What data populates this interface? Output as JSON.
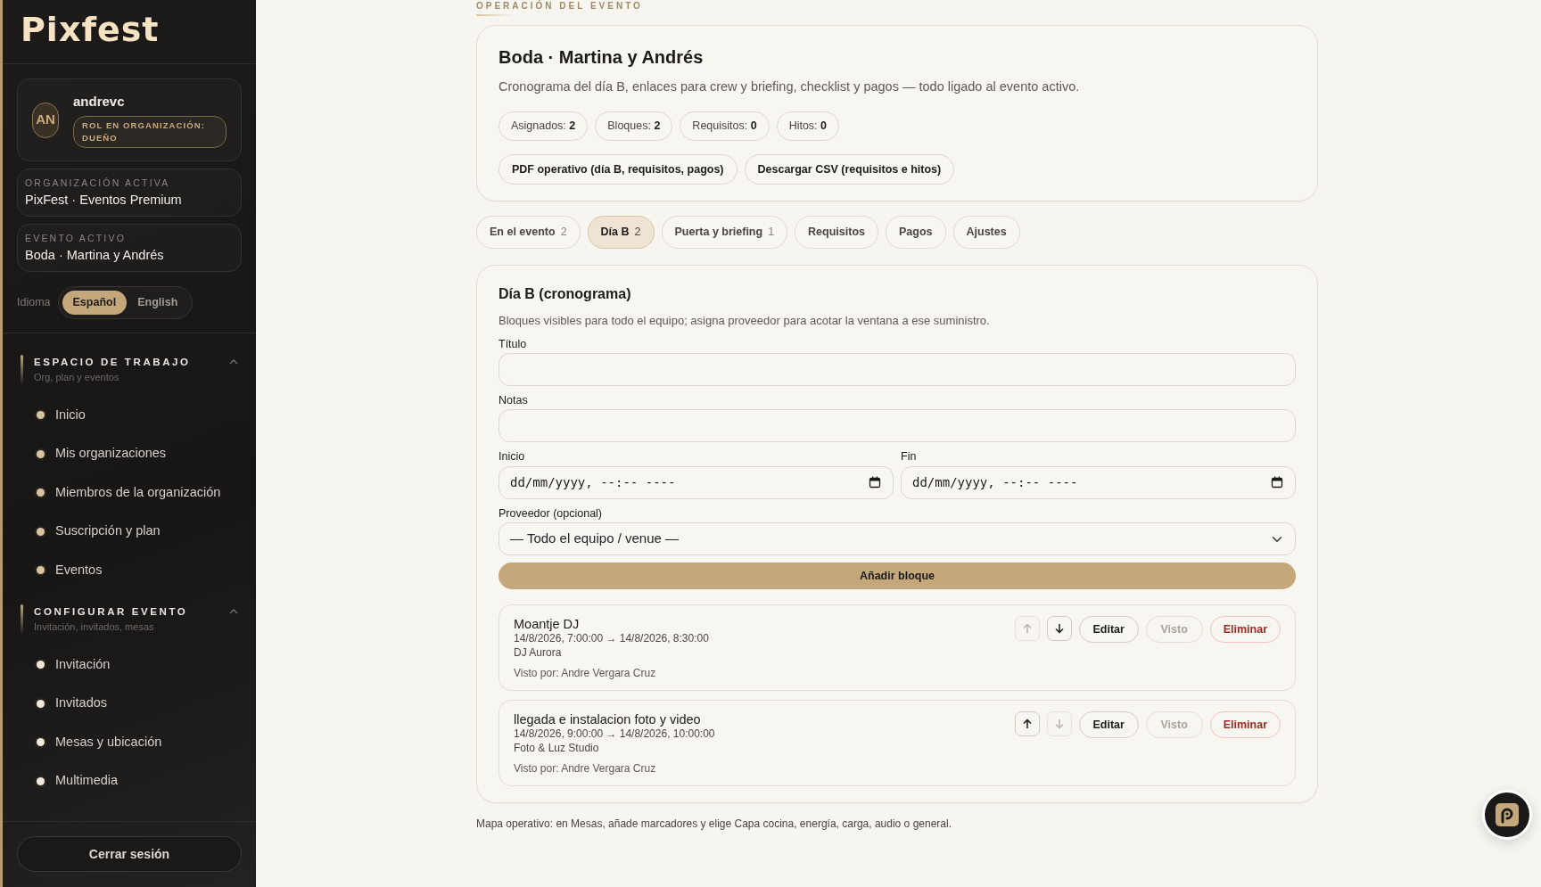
{
  "sidebar": {
    "logo": "Pixfest",
    "user": {
      "initials": "AN",
      "name": "andrevc",
      "role": "ROL EN ORGANIZACIÓN: DUEÑO"
    },
    "org": {
      "label": "ORGANIZACIÓN ACTIVA",
      "value": "PixFest · Eventos Premium"
    },
    "event": {
      "label": "EVENTO ACTIVO",
      "value": "Boda · Martina y Andrés"
    },
    "language": {
      "label": "Idioma",
      "options": [
        {
          "label": "Español",
          "selected": true
        },
        {
          "label": "English",
          "selected": false
        }
      ]
    },
    "sections": [
      {
        "title": "ESPACIO DE TRABAJO",
        "subtitle": "Org, plan y eventos",
        "expanded": true,
        "items": [
          "Inicio",
          "Mis organizaciones",
          "Miembros de la organización",
          "Suscripción y plan",
          "Eventos"
        ]
      },
      {
        "title": "CONFIGURAR EVENTO",
        "subtitle": "Invitación, invitados, mesas",
        "expanded": true,
        "items": [
          "Invitación",
          "Invitados",
          "Mesas y ubicación",
          "Multimedia"
        ]
      }
    ],
    "logout": "Cerrar sesión"
  },
  "main": {
    "eyebrow": "OPERACIÓN DEL EVENTO",
    "header": {
      "title": "Boda · Martina y Andrés",
      "description": "Cronograma del día B, enlaces para crew y briefing, checklist y pagos — todo ligado al evento activo.",
      "stats": [
        {
          "label": "Asignados:",
          "value": "2"
        },
        {
          "label": "Bloques:",
          "value": "2"
        },
        {
          "label": "Requisitos:",
          "value": "0"
        },
        {
          "label": "Hitos:",
          "value": "0"
        }
      ],
      "actions": [
        "PDF operativo (día B, requisitos, pagos)",
        "Descargar CSV (requisitos e hitos)"
      ]
    },
    "tabs": [
      {
        "label": "En el evento",
        "count": "2",
        "selected": false
      },
      {
        "label": "Día B",
        "count": "2",
        "selected": true
      },
      {
        "label": "Puerta y briefing",
        "count": "1",
        "selected": false
      },
      {
        "label": "Requisitos",
        "selected": false
      },
      {
        "label": "Pagos",
        "selected": false
      },
      {
        "label": "Ajustes",
        "selected": false
      }
    ],
    "panel": {
      "title": "Día B (cronograma)",
      "description": "Bloques visibles para todo el equipo; asigna proveedor para acotar la ventana a ese suministro.",
      "fields": [
        {
          "kind": "text",
          "label": "Título"
        },
        {
          "kind": "text",
          "label": "Notas"
        },
        {
          "kind": "datetime",
          "label": "Inicio",
          "placeholder": "dd/mm/yyyy, --:-- ----"
        },
        {
          "kind": "datetime",
          "label": "Fin",
          "placeholder": "dd/mm/yyyy, --:-- ----"
        },
        {
          "kind": "select",
          "label": "Proveedor (opcional)",
          "value": "— Todo el equipo / venue —"
        }
      ],
      "submit": "Añadir bloque",
      "blocks": [
        {
          "title": "Moantje DJ",
          "time": "14/8/2026, 7:00:00 → 14/8/2026, 8:30:00",
          "vendor": "DJ Aurora",
          "seen_by": "Visto por: Andre Vergara Cruz",
          "move_up_disabled": true,
          "move_down_disabled": false,
          "actions": [
            {
              "kind": "edit",
              "label": "Editar",
              "disabled": false
            },
            {
              "kind": "seen",
              "label": "Visto",
              "disabled": true
            },
            {
              "kind": "delete",
              "label": "Eliminar",
              "disabled": false
            }
          ]
        },
        {
          "title": "llegada e instalacion foto y video",
          "time": "14/8/2026, 9:00:00 → 14/8/2026, 10:00:00",
          "vendor": "Foto & Luz Studio",
          "seen_by": "Visto por: Andre Vergara Cruz",
          "move_up_disabled": false,
          "move_down_disabled": true,
          "actions": [
            {
              "kind": "edit",
              "label": "Editar",
              "disabled": false
            },
            {
              "kind": "seen",
              "label": "Visto",
              "disabled": true
            },
            {
              "kind": "delete",
              "label": "Eliminar",
              "disabled": false
            }
          ]
        }
      ]
    },
    "footnote": "Mapa operativo: en Mesas, añade marcadores y elige Capa cocina, energía, carga, audio o general."
  }
}
